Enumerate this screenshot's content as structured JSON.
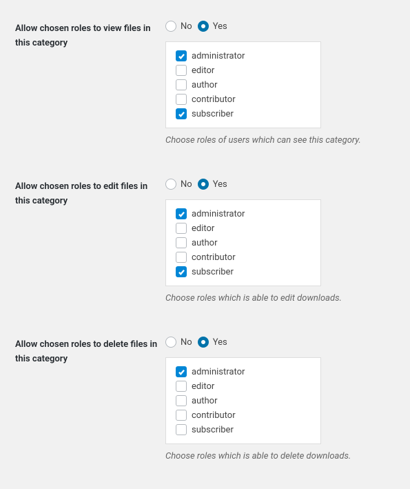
{
  "options": {
    "no": "No",
    "yes": "Yes"
  },
  "sections": [
    {
      "label": "Allow chosen roles to view files in this category",
      "selected": "yes",
      "roles": [
        {
          "label": "administrator",
          "checked": true
        },
        {
          "label": "editor",
          "checked": false
        },
        {
          "label": "author",
          "checked": false
        },
        {
          "label": "contributor",
          "checked": false
        },
        {
          "label": "subscriber",
          "checked": true
        }
      ],
      "hint": "Choose roles of users which can see this category."
    },
    {
      "label": "Allow chosen roles to edit files in this category",
      "selected": "yes",
      "roles": [
        {
          "label": "administrator",
          "checked": true
        },
        {
          "label": "editor",
          "checked": false
        },
        {
          "label": "author",
          "checked": false
        },
        {
          "label": "contributor",
          "checked": false
        },
        {
          "label": "subscriber",
          "checked": true
        }
      ],
      "hint": "Choose roles which is able to edit downloads."
    },
    {
      "label": "Allow chosen roles to delete files in this category",
      "selected": "yes",
      "roles": [
        {
          "label": "administrator",
          "checked": true
        },
        {
          "label": "editor",
          "checked": false
        },
        {
          "label": "author",
          "checked": false
        },
        {
          "label": "contributor",
          "checked": false
        },
        {
          "label": "subscriber",
          "checked": false
        }
      ],
      "hint": "Choose roles which is able to delete downloads."
    }
  ]
}
